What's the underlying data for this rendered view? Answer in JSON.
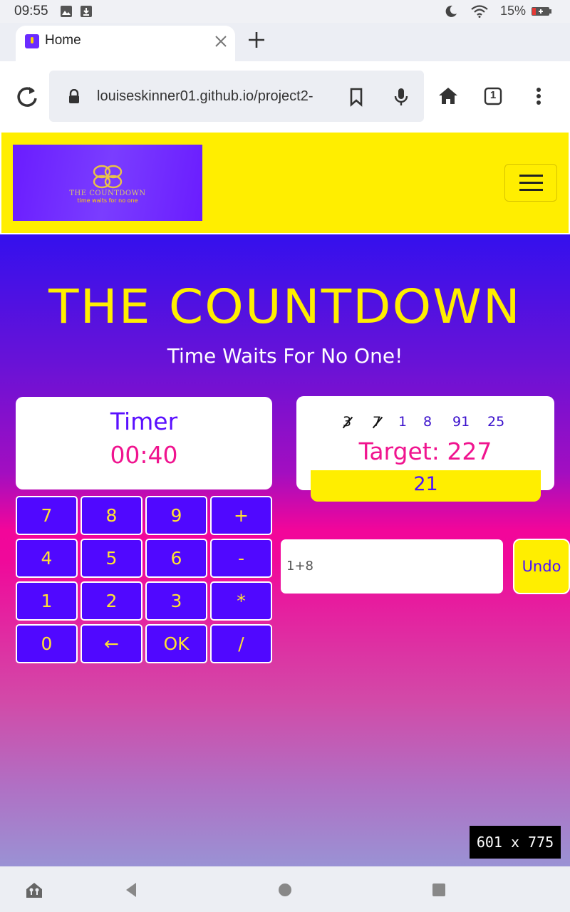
{
  "status_bar": {
    "time": "09:55",
    "battery": "15%"
  },
  "browser": {
    "tab_title": "Home",
    "url": "louiseskinner01.github.io/project2-",
    "tab_count": "1"
  },
  "site": {
    "logo_title": "THE COUNTDOWN",
    "logo_tagline": "time waits for no one",
    "hero_title": "THE COUNTDOWN",
    "hero_subtitle": "Time Waits For No One!"
  },
  "timer": {
    "label": "Timer",
    "value": "00:40"
  },
  "game": {
    "numbers": [
      {
        "value": "3",
        "used": true
      },
      {
        "value": "7",
        "used": true
      },
      {
        "value": "1",
        "used": false
      },
      {
        "value": "8",
        "used": false
      },
      {
        "value": "91",
        "used": false
      },
      {
        "value": "25",
        "used": false
      }
    ],
    "target": "Target: 227",
    "current_result": "21",
    "equation": "1+8",
    "undo_label": "Undo"
  },
  "keypad": {
    "rows": [
      [
        "7",
        "8",
        "9",
        "+"
      ],
      [
        "4",
        "5",
        "6",
        "-"
      ],
      [
        "1",
        "2",
        "3",
        "*"
      ],
      [
        "0",
        "←",
        "OK",
        "/"
      ]
    ]
  },
  "viewport_badge": "601 x 775"
}
